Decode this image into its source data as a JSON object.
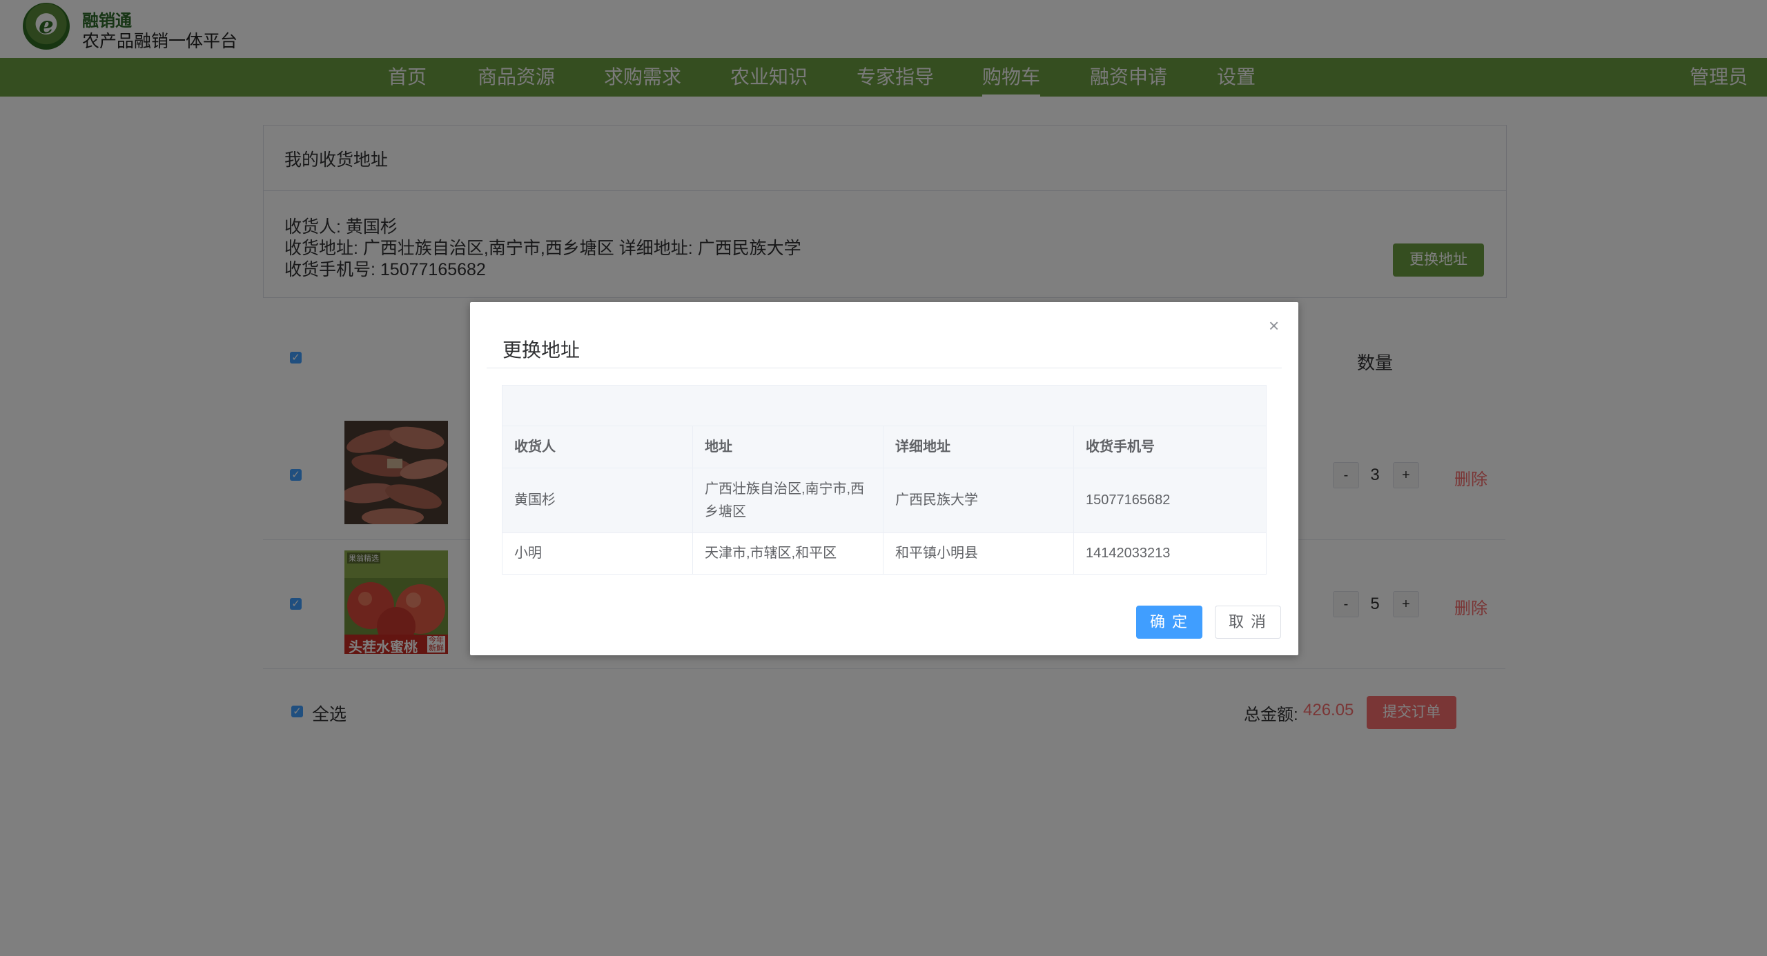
{
  "header": {
    "brand_name": "融销通",
    "brand_subtitle": "农产品融销一体平台",
    "logo_letter": "e"
  },
  "nav": {
    "items": [
      "首页",
      "商品资源",
      "求购需求",
      "农业知识",
      "专家指导",
      "购物车",
      "融资申请",
      "设置"
    ],
    "active": "购物车",
    "user": "管理员"
  },
  "address_panel": {
    "title": "我的收货地址",
    "receiver": "收货人: 黄国杉",
    "address": "收货地址: 广西壮族自治区,南宁市,西乡塘区 详细地址: 广西民族大学",
    "phone": "收货手机号: 15077165682",
    "change_button": "更换地址"
  },
  "cart": {
    "quantity_header": "数量",
    "items": [
      {
        "image": "sweet-potato",
        "quantity": "3",
        "delete_label": "删除"
      },
      {
        "image": "peach",
        "quantity": "5",
        "delete_label": "删除",
        "image_text": "头茬水蜜桃",
        "image_tag": "果翁精选",
        "image_badge": "今年新鲜"
      }
    ],
    "minus": "-",
    "plus": "+",
    "select_all": "全选",
    "total_label": "总金额:",
    "total_value": "426.05",
    "submit_button": "提交订单"
  },
  "dialog": {
    "title": "更换地址",
    "close": "×",
    "columns": [
      "收货人",
      "地址",
      "详细地址",
      "收货手机号"
    ],
    "rows": [
      [
        "黄国杉",
        "广西壮族自治区,南宁市,西乡塘区",
        "广西民族大学",
        "15077165682"
      ],
      [
        "小明",
        "天津市,市辖区,和平区",
        "和平镇小明县",
        "14142033213"
      ]
    ],
    "confirm_button": "确 定",
    "cancel_button": "取 消"
  },
  "colors": {
    "nav_green": "#6a9c40",
    "primary_blue": "#409eff",
    "danger_red": "#f56c6c"
  }
}
